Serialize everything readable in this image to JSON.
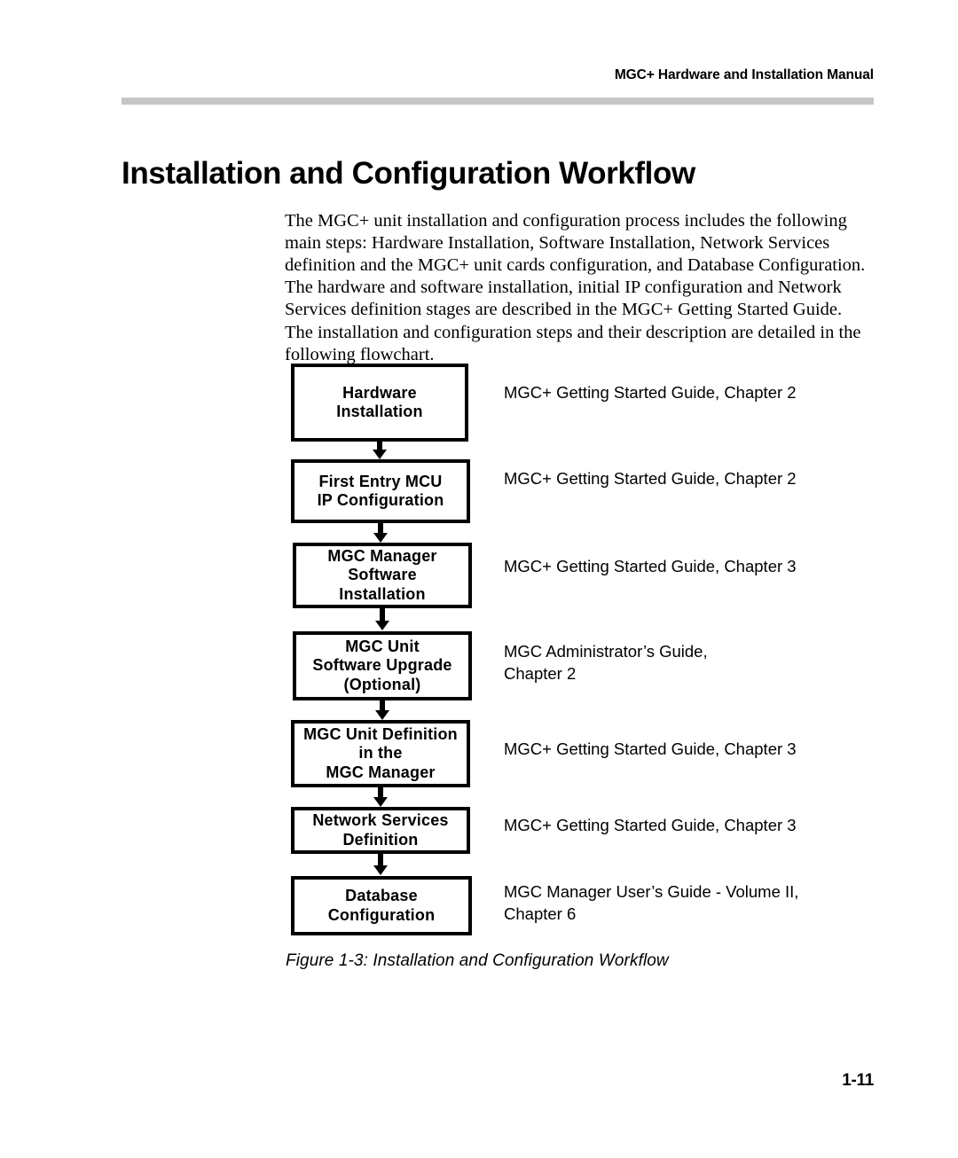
{
  "header": {
    "running_head": "MGC+ Hardware and Installation Manual",
    "rule_color": "#c6c6c6"
  },
  "page_title": "Installation and Configuration Workflow",
  "intro_paragraph": "The MGC+ unit installation and configuration process includes the following main steps: Hardware Installation, Software Installation, Network Services definition and the MGC+ unit cards configuration, and Database Configuration. The hardware and software installation, initial IP configuration and Network Services definition stages are described in the MGC+ Getting Started Guide. The installation and configuration steps and their description are detailed in the following flowchart.",
  "flowchart": {
    "box_border_color": "#000000",
    "box_fill_color": "#ffffff",
    "steps": [
      {
        "label": "Hardware\nInstallation",
        "annotation": "MGC+ Getting Started Guide, Chapter 2"
      },
      {
        "label": "First Entry MCU\nIP Configuration",
        "annotation": "MGC+ Getting Started Guide, Chapter 2"
      },
      {
        "label": "MGC Manager\nSoftware\nInstallation",
        "annotation": "MGC+ Getting Started Guide, Chapter 3"
      },
      {
        "label": "MGC Unit\nSoftware Upgrade\n(Optional)",
        "annotation": "MGC Administrator’s Guide,\nChapter 2"
      },
      {
        "label": "MGC Unit Definition\nin the\nMGC Manager",
        "annotation": "MGC+ Getting Started Guide, Chapter 3"
      },
      {
        "label": "Network Services\nDefinition",
        "annotation": "MGC+ Getting Started Guide, Chapter 3"
      },
      {
        "label": "Database\nConfiguration",
        "annotation": "MGC Manager User’s Guide - Volume II,\nChapter 6"
      }
    ]
  },
  "figure_caption": "Figure 1-3: Installation and Configuration Workflow",
  "page_number": "1-11"
}
